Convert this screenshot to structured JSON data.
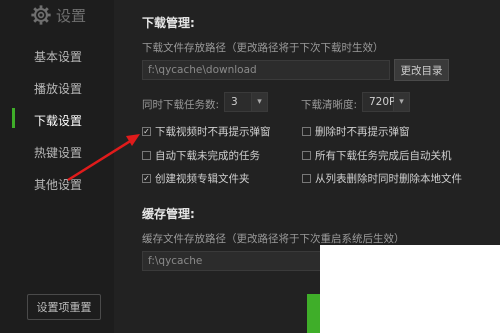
{
  "sidebar": {
    "title": "设置",
    "items": [
      {
        "label": "基本设置"
      },
      {
        "label": "播放设置"
      },
      {
        "label": "下载设置",
        "active": true
      },
      {
        "label": "热键设置"
      },
      {
        "label": "其他设置"
      }
    ],
    "reset_label": "设置项重置"
  },
  "download": {
    "section_title": "下载管理:",
    "path_label": "下载文件存放路径（更改路径将于下次下载时生效）",
    "path_value": "f:\\qycache\\download",
    "change_dir_label": "更改目录",
    "concurrent_label": "同时下载任务数:",
    "concurrent_value": "3",
    "quality_label": "下载清晰度:",
    "quality_value": "720P",
    "options": [
      {
        "label": "下载视频时不再提示弹窗",
        "checked": true
      },
      {
        "label": "删除时不再提示弹窗",
        "checked": false
      },
      {
        "label": "自动下载未完成的任务",
        "checked": false
      },
      {
        "label": "所有下载任务完成后自动关机",
        "checked": false
      },
      {
        "label": "创建视频专辑文件夹",
        "checked": true
      },
      {
        "label": "从列表删除时同时删除本地文件",
        "checked": false
      }
    ]
  },
  "cache": {
    "section_title": "缓存管理:",
    "path_label": "缓存文件存放路径（更改路径将于下次重启系统后生效）",
    "path_value": "f:\\qycache"
  },
  "colors": {
    "accent": "#3fae29",
    "arrow": "#e01b1b"
  },
  "icons": {
    "settings": "gear-icon",
    "dropdown": "chevron-down-icon",
    "check": "check-icon"
  }
}
